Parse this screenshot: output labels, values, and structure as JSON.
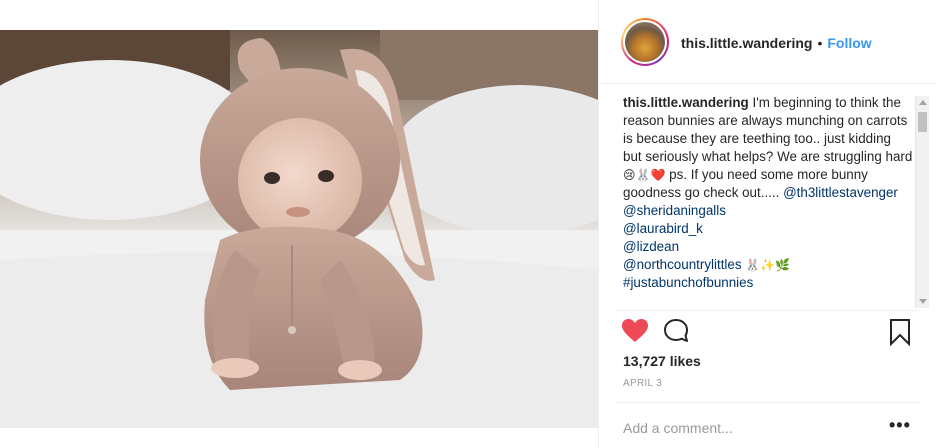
{
  "post": {
    "username": "this.little.wandering",
    "separator": "•",
    "follow_label": "Follow",
    "caption": {
      "username": "this.little.wandering",
      "text_1": "I'm beginning to think the reason bunnies are always munching on carrots is because they are teething too.. just kidding but seriously what helps? We are struggling hard ",
      "emoji_1": "😢🐰❤️",
      "text_2": " ps. If you need some more bunny goodness go check out..... ",
      "mentions": [
        "@th3littlestavenger",
        "@sheridaningalls",
        "@laurabird_k",
        "@lizdean",
        "@northcountrylittles"
      ],
      "emoji_2": "🐰✨🌿",
      "hashtags": [
        "#justabunchofbunnies"
      ]
    },
    "likes": "13,727 likes",
    "date": "APRIL 3",
    "comment_placeholder": "Add a comment...",
    "more_label": "•••"
  },
  "icons": {
    "like": "heart-icon",
    "comment": "speech-bubble-icon",
    "save": "bookmark-icon",
    "more": "ellipsis-icon"
  },
  "colors": {
    "link": "#003569",
    "follow": "#3897f0",
    "heart": "#ed4956",
    "muted": "#999999"
  }
}
